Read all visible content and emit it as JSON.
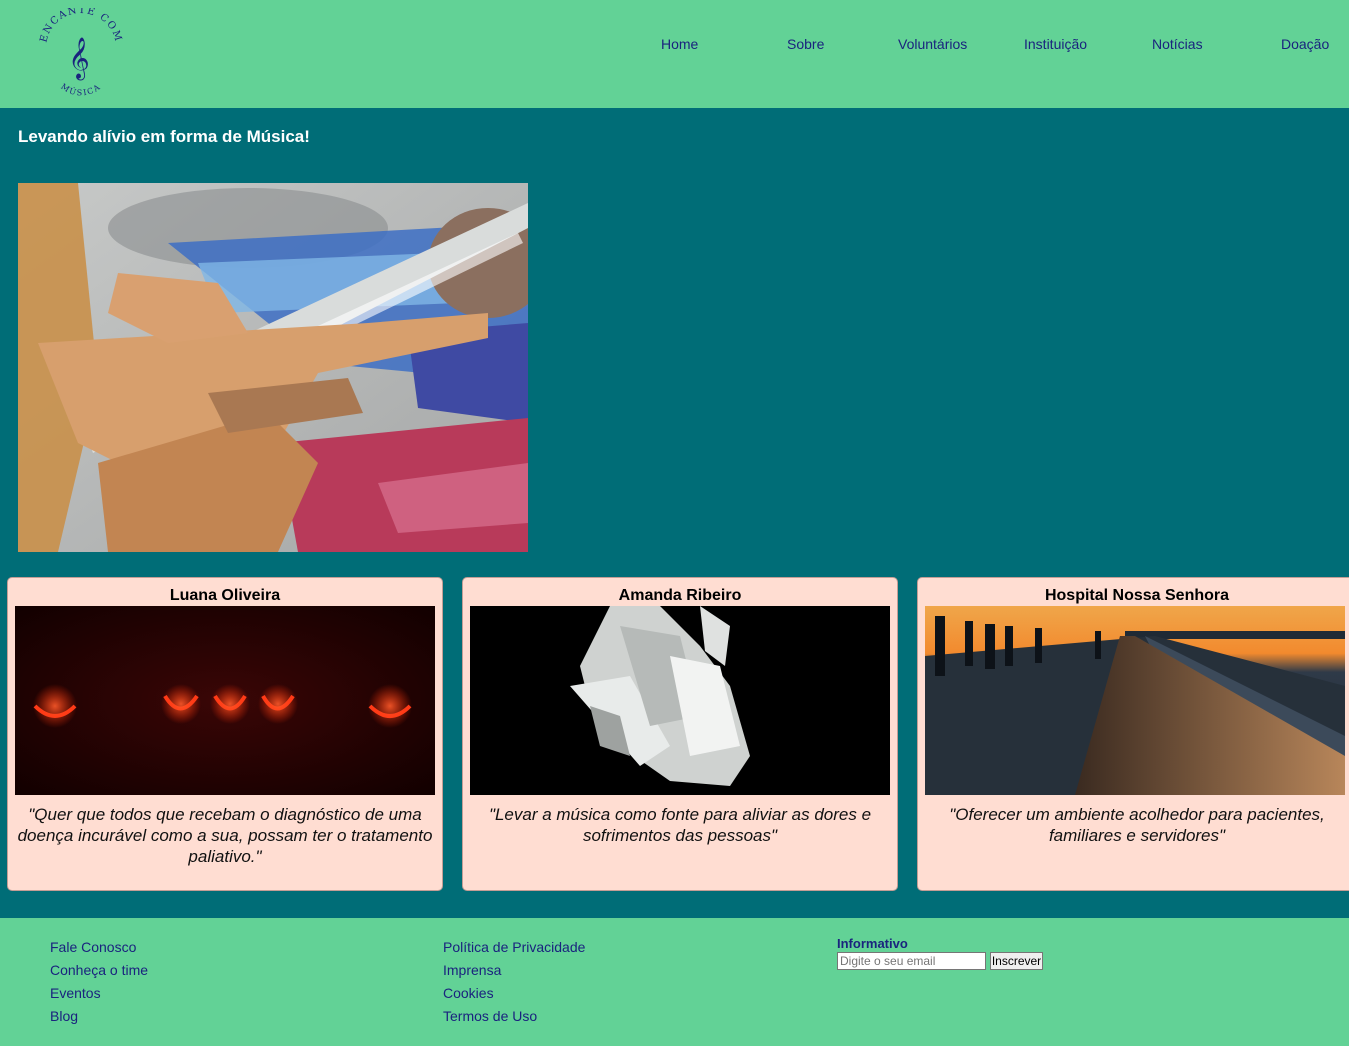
{
  "brand": {
    "logo_text_top": "ENCANTE COM",
    "logo_text_bottom": "MÚSICA",
    "logo_icon": "treble-clef-icon"
  },
  "nav": {
    "items": [
      "Home",
      "Sobre",
      "Voluntários",
      "Instituição",
      "Notícias",
      "Doação"
    ]
  },
  "main": {
    "tagline": "Levando alívio em forma de Música!",
    "hero_image": "hands-holding-hospital-bed-rail"
  },
  "cards": [
    {
      "title": "Luana Oliveira",
      "image": "red-lights-dark-image",
      "quote": "\"Quer que todos que recebam o diagnóstico de uma doença incurável como a sua, possam ter o tratamento paliativo.\""
    },
    {
      "title": "Amanda Ribeiro",
      "image": "quartz-crystal-image",
      "quote": "\"Levar a música como fonte para aliviar as dores e sofrimentos das pessoas\""
    },
    {
      "title": "Hospital Nossa Senhora",
      "image": "pier-sunset-image",
      "quote": "\"Oferecer um ambiente acolhedor para pacientes, familiares e servidores\""
    }
  ],
  "footer": {
    "col1": [
      "Fale Conosco",
      "Conheça o time",
      "Eventos",
      "Blog"
    ],
    "col2": [
      "Política de Privacidade",
      "Imprensa",
      "Cookies",
      "Termos de Uso"
    ],
    "newsletter": {
      "title": "Informativo",
      "placeholder": "Digite o seu email",
      "button": "Inscrever"
    }
  },
  "colors": {
    "header_footer_bg": "#62d296",
    "main_bg": "#006d77",
    "card_bg": "#ffddd2",
    "link": "#1a237e"
  }
}
